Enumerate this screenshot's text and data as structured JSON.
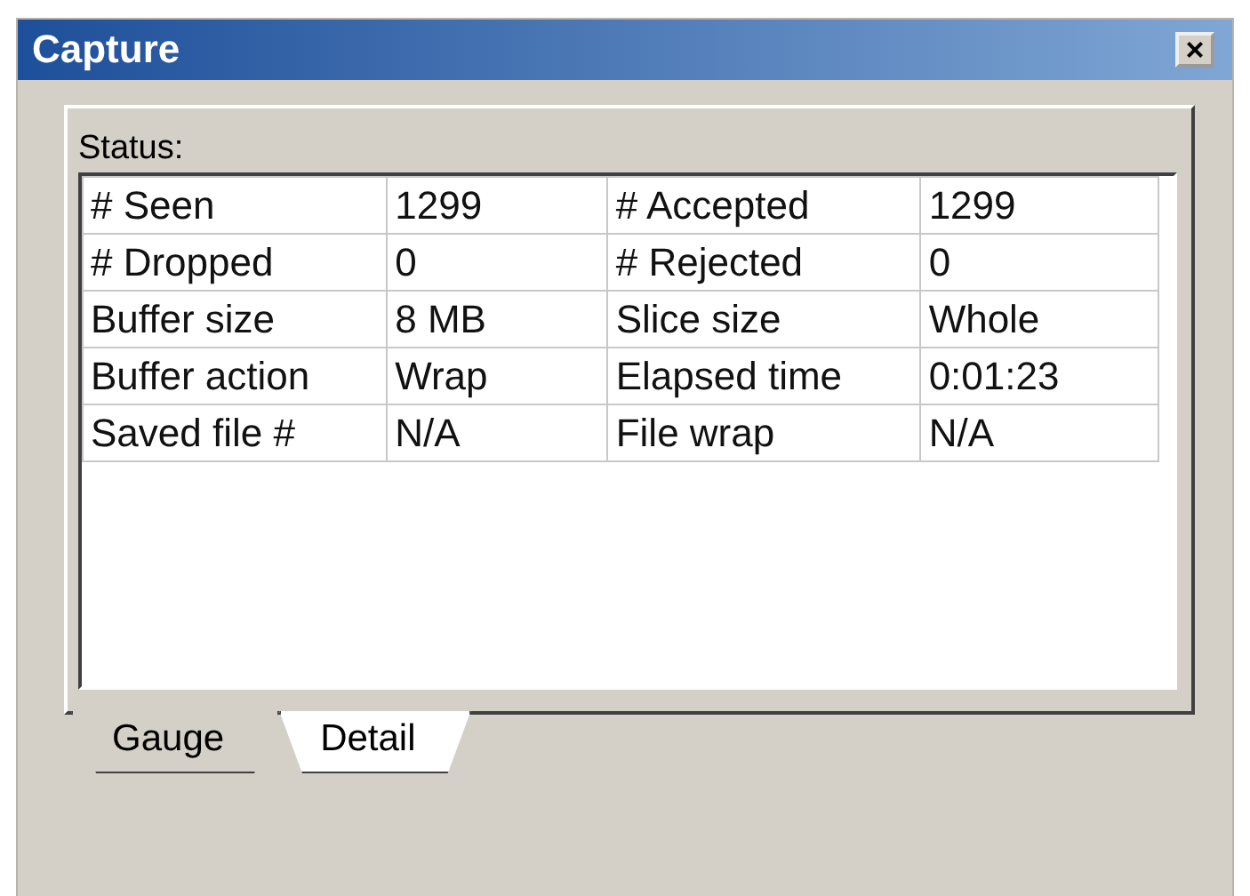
{
  "window": {
    "title": "Capture",
    "close": "×"
  },
  "status": {
    "label": "Status:",
    "rows": [
      {
        "cells": [
          "# Seen",
          "1299",
          "# Accepted",
          "1299"
        ]
      },
      {
        "cells": [
          "# Dropped",
          "0",
          "# Rejected",
          "0"
        ]
      },
      {
        "cells": [
          "Buffer size",
          "8 MB",
          "Slice size",
          "Whole"
        ]
      },
      {
        "cells": [
          "Buffer action",
          "Wrap",
          "Elapsed time",
          "0:01:23"
        ]
      },
      {
        "cells": [
          "Saved file #",
          "N/A",
          "File wrap",
          "N/A"
        ]
      }
    ]
  },
  "tabs": [
    {
      "label": "Gauge",
      "selected": false
    },
    {
      "label": "Detail",
      "selected": true
    }
  ]
}
